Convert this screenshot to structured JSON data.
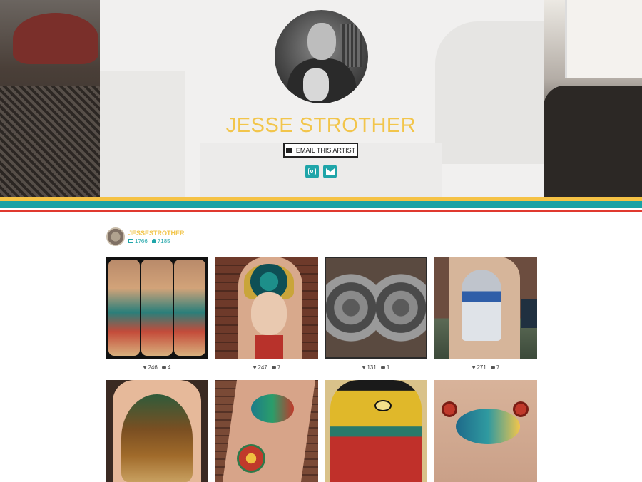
{
  "artist": {
    "name": "JESSE STROTHER",
    "email_button_label": "EMAIL THIS ARTIST"
  },
  "social_icons": [
    "instagram-icon",
    "email-icon"
  ],
  "colors": {
    "accent_yellow": "#f2c54b",
    "accent_teal": "#19a2a5",
    "accent_red": "#e0392f"
  },
  "instagram_profile": {
    "username": "JESSESTROTHER",
    "posts_count": "1766",
    "followers_count": "7185"
  },
  "posts": [
    {
      "likes": "246",
      "comments": "4"
    },
    {
      "likes": "247",
      "comments": "7"
    },
    {
      "likes": "131",
      "comments": "1"
    },
    {
      "likes": "271",
      "comments": "7"
    },
    {
      "likes": "",
      "comments": ""
    },
    {
      "likes": "",
      "comments": ""
    },
    {
      "likes": "",
      "comments": ""
    },
    {
      "likes": "",
      "comments": ""
    }
  ]
}
